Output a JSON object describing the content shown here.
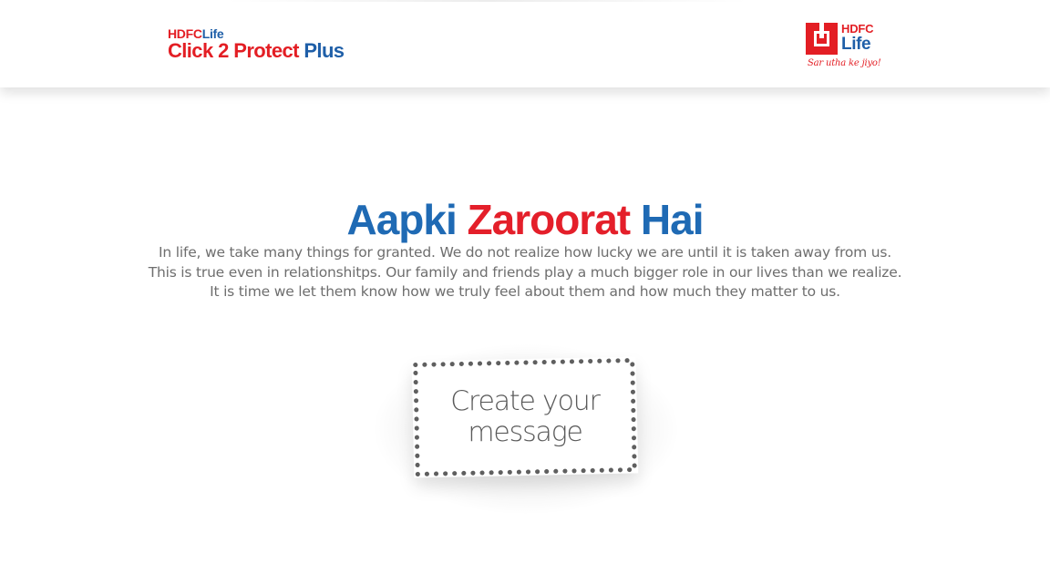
{
  "header": {
    "product_logo": {
      "brand_hdfc": "HDFC",
      "brand_life": "Life",
      "product_name": "Click 2 Protect",
      "product_suffix": "Plus"
    },
    "company_logo": {
      "line1": "HDFC",
      "line2": "Life",
      "tagline": "Sar utha ke jiyo!"
    }
  },
  "main": {
    "headline": {
      "part1": "Aapki",
      "part2": "Zaroorat",
      "part3": "Hai"
    },
    "intro_lines": [
      "In life, we take many things for granted. We do not realize how lucky we are until it is taken away from us.",
      "This is true even in relationshitps. Our family and friends play a much bigger role in our lives than we realize.",
      "It is time we let them know how we truly feel about them and how much they matter to  us."
    ],
    "cta": {
      "line1": "Create your",
      "line2": "message"
    }
  },
  "colors": {
    "brand_red": "#e31e24",
    "brand_blue": "#1f5fa8",
    "body_text": "#6e6e6e"
  }
}
